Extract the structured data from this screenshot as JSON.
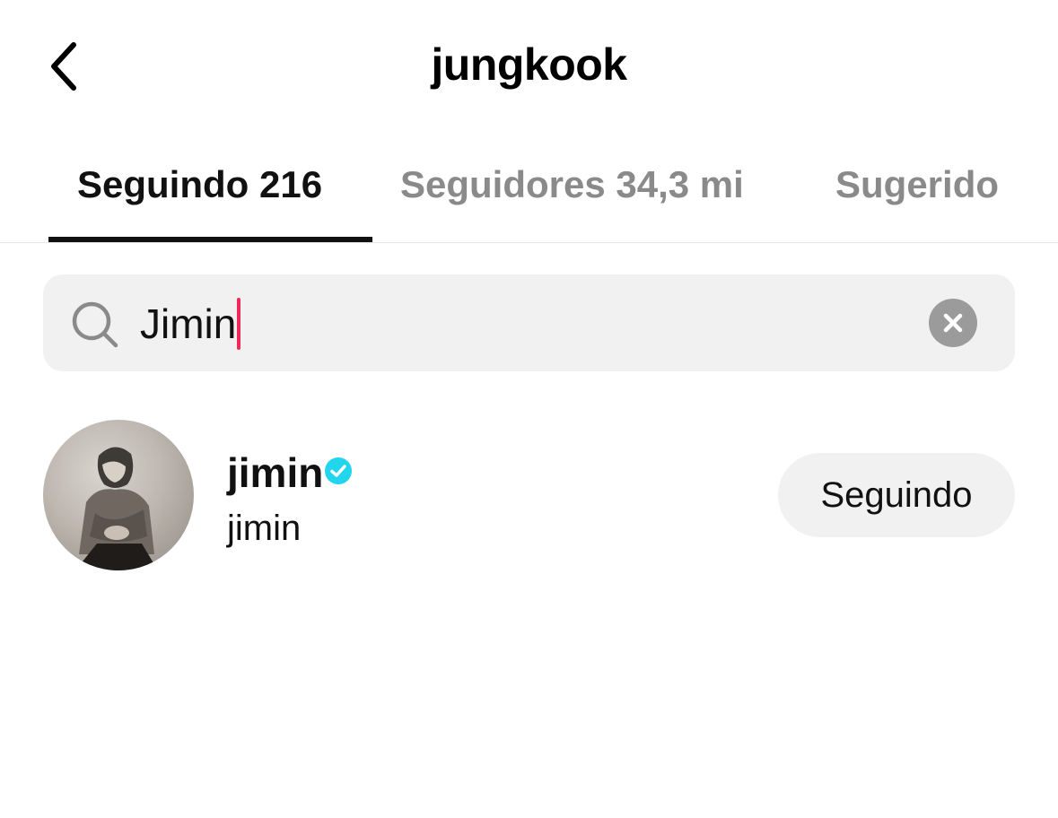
{
  "header": {
    "title": "jungkook",
    "back_icon": "chevron-left-icon"
  },
  "tabs": [
    {
      "label": "Seguindo 216",
      "active": true
    },
    {
      "label": "Seguidores 34,3 mi",
      "active": false
    },
    {
      "label": "Sugerido",
      "active": false
    }
  ],
  "search": {
    "value": "Jimin",
    "search_icon": "search-icon",
    "clear_icon": "clear-icon",
    "caret_color": "#ee2a5a"
  },
  "results": [
    {
      "username": "jimin",
      "display_name": "jimin",
      "verified": true,
      "verified_color": "#20d5ec",
      "button_label": "Seguindo"
    }
  ],
  "colors": {
    "inactive_tab": "#8a8a8a",
    "search_bg": "#f1f1f2"
  }
}
